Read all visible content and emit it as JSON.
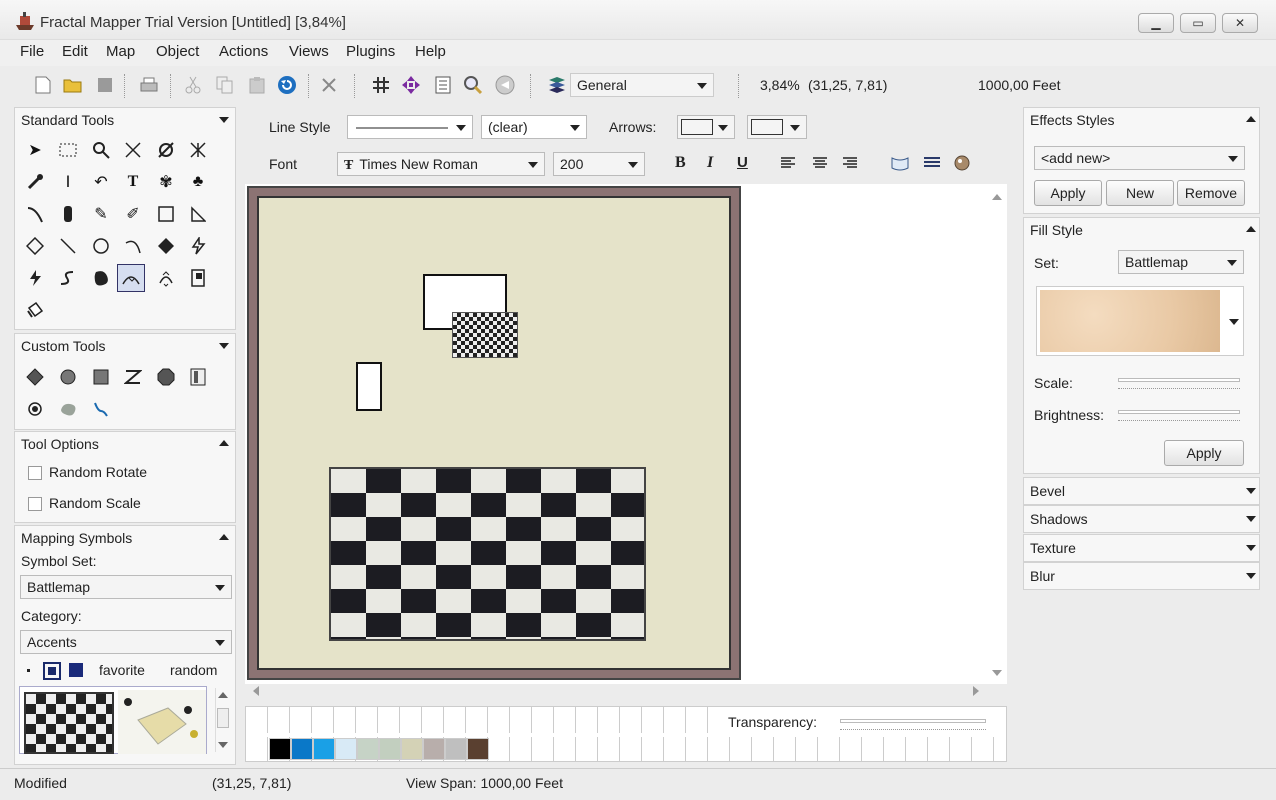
{
  "window": {
    "title": "Fractal Mapper Trial Version [Untitled] [3,84%]"
  },
  "menu": [
    "File",
    "Edit",
    "Map",
    "Object",
    "Actions",
    "Views",
    "Plugins",
    "Help"
  ],
  "toolbar": {
    "layer": "General",
    "zoom": "3,84%",
    "coords": "(31,25, 7,81)",
    "span": "1000,00 Feet"
  },
  "format": {
    "line_style_label": "Line Style",
    "fill_value": "(clear)",
    "arrows_label": "Arrows:",
    "font_label": "Font",
    "font_name": "Times New Roman",
    "font_size": "200",
    "bold": "B",
    "italic": "I",
    "underline": "U"
  },
  "left": {
    "standard_tools": "Standard Tools",
    "custom_tools": "Custom Tools",
    "tool_options": "Tool Options",
    "random_rotate": "Random Rotate",
    "random_scale": "Random Scale",
    "mapping_symbols": "Mapping Symbols",
    "symbol_set_label": "Symbol Set:",
    "symbol_set": "Battlemap",
    "category_label": "Category:",
    "category": "Accents",
    "favorite": "favorite",
    "random": "random"
  },
  "right": {
    "effects_styles": "Effects Styles",
    "add_new": "<add new>",
    "apply": "Apply",
    "new": "New",
    "remove": "Remove",
    "fill_style": "Fill Style",
    "set_label": "Set:",
    "set_value": "Battlemap",
    "scale_label": "Scale:",
    "brightness_label": "Brightness:",
    "apply2": "Apply",
    "bevel": "Bevel",
    "shadows": "Shadows",
    "texture": "Texture",
    "blur": "Blur"
  },
  "palette": {
    "transparency_label": "Transparency:",
    "colors": [
      "#000000",
      "#0a78c8",
      "#1aa0e6",
      "#d8eaf6",
      "#c6d3c6",
      "#c2cfbf",
      "#d4d2b6",
      "#b8aeab",
      "#bfbfbf",
      "#5a4030"
    ]
  },
  "status": {
    "modified": "Modified",
    "coords": "(31,25, 7,81)",
    "view_span": "View Span: 1000,00 Feet"
  }
}
